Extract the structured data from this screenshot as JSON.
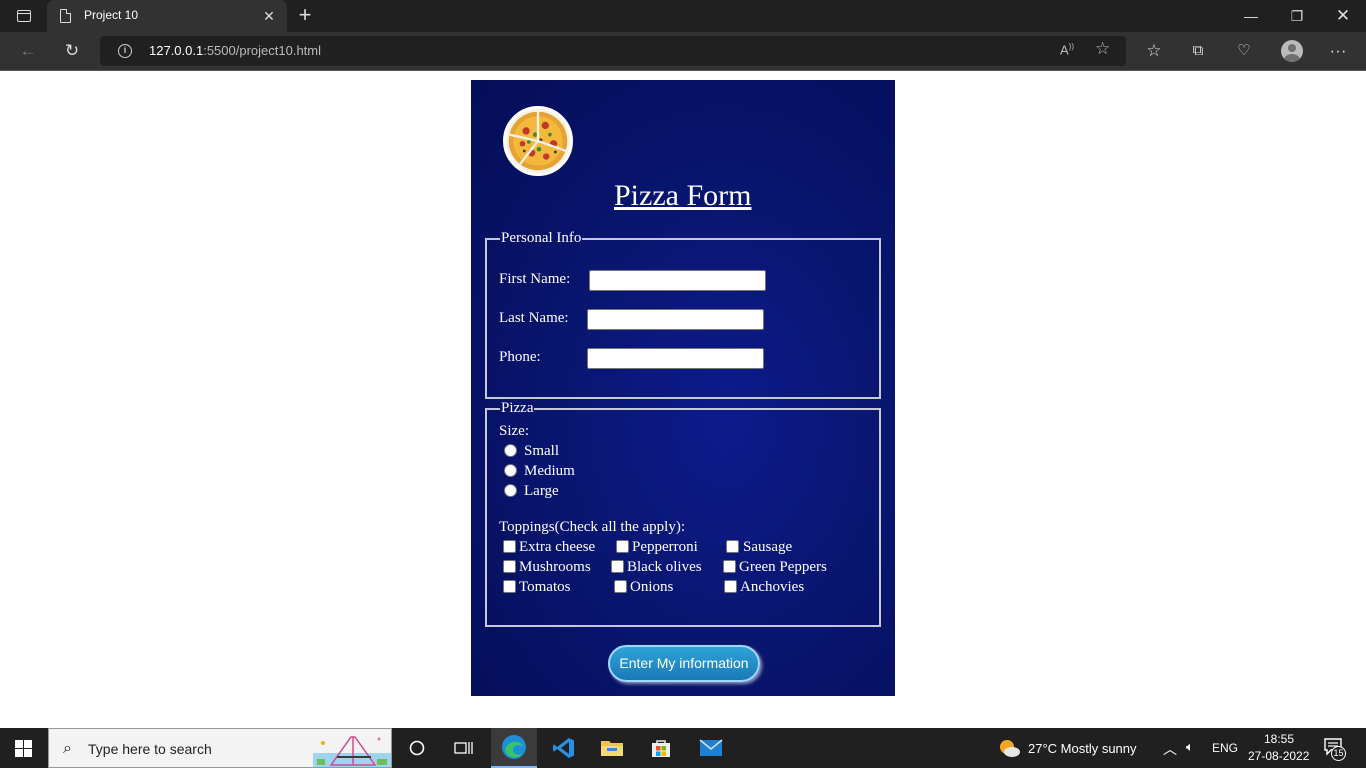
{
  "browser": {
    "tab_title": "Project 10",
    "url_host": "127.0.0.1",
    "url_rest": ":5500/project10.html"
  },
  "form": {
    "title": "Pizza Form",
    "personal_legend": "Personal Info",
    "first_name_label": "First Name:",
    "last_name_label": "Last Name:",
    "phone_label": "Phone:",
    "pizza_legend": "Pizza",
    "size_label": "Size:",
    "sizes": [
      "Small",
      "Medium",
      "Large"
    ],
    "toppings_label": "Toppings(Check all the apply):",
    "toppings": [
      "Extra cheese",
      "Pepperroni",
      "Sausage",
      "Mushrooms",
      "Black olives",
      "Green Peppers",
      "Tomatos",
      "Onions",
      "Anchovies"
    ],
    "submit_label": "Enter My information"
  },
  "taskbar": {
    "search_placeholder": "Type here to search",
    "weather": "27°C  Mostly sunny",
    "lang": "ENG",
    "time": "18:55",
    "date": "27-08-2022",
    "notification_count": "15"
  }
}
